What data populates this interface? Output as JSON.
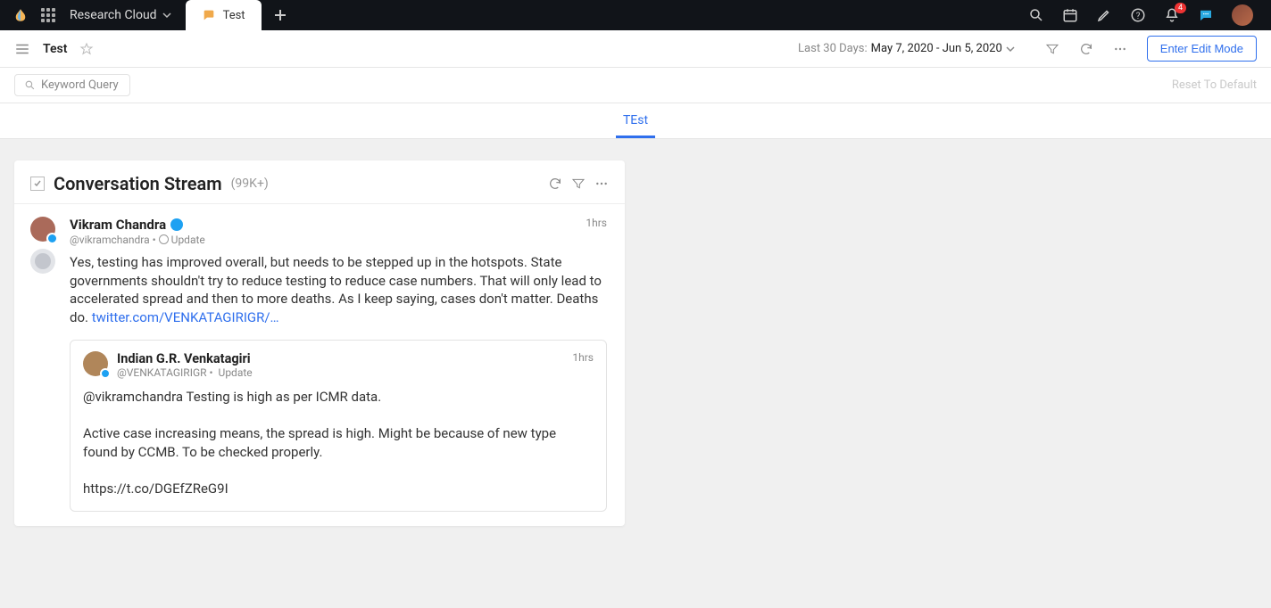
{
  "topbar": {
    "workspace": "Research Cloud",
    "tab_label": "Test",
    "notif_badge": "4"
  },
  "secbar": {
    "title": "Test",
    "daterange_prefix": "Last 30 Days: ",
    "daterange_value": "May 7, 2020 - Jun 5, 2020",
    "enter_edit": "Enter Edit Mode"
  },
  "querybar": {
    "placeholder": "Keyword Query",
    "reset": "Reset To Default"
  },
  "subtab": {
    "label": "TEst"
  },
  "widget": {
    "title": "Conversation Stream",
    "count": "(99K+)"
  },
  "post": {
    "author": "Vikram Chandra",
    "handle": "@vikramchandra",
    "meta_sep": " • ",
    "meta_action": "Update",
    "time": "1hrs",
    "body_text": "Yes, testing has improved overall, but needs to be stepped up in the hotspots. State governments shouldn't try to reduce testing to reduce case numbers. That will only lead to accelerated spread and then to more deaths. As I keep saying, cases don't matter. Deaths do. ",
    "link_text": "twitter.com/VENKATAGIRIGR/…"
  },
  "quote": {
    "author": "Indian G.R. Venkatagiri",
    "handle": "@VENKATAGIRIGR",
    "meta_sep": " • ",
    "meta_action": "Update",
    "time": "1hrs",
    "body": "@vikramchandra Testing is high as per ICMR data.\n\nActive case increasing means, the spread is high. Might be because of new type found by CCMB. To be checked properly.\n\nhttps://t.co/DGEfZReG9I"
  }
}
